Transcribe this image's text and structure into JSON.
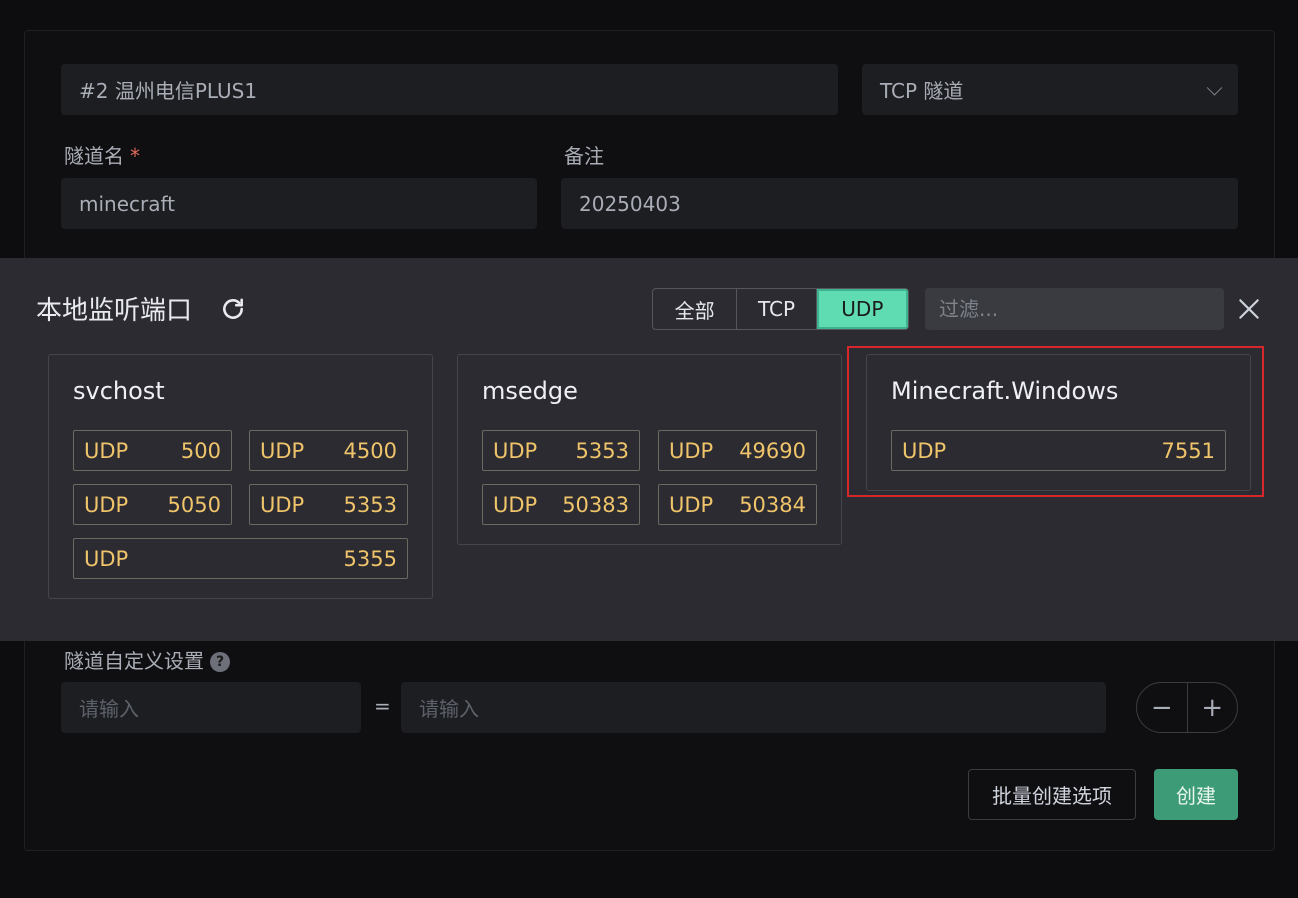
{
  "form": {
    "node_value": "#2 温州电信PLUS1",
    "tunnel_type_value": "TCP 隧道",
    "tunnel_name_label": "隧道名",
    "required_mark": "*",
    "tunnel_name_value": "minecraft",
    "remark_label": "备注",
    "remark_value": "20250403",
    "custom_settings_label": "隧道自定义设置",
    "help_glyph": "?",
    "key_placeholder": "请输入",
    "equals": "=",
    "value_placeholder": "请输入",
    "minus": "−",
    "plus": "+",
    "batch_button": "批量创建选项",
    "create_button": "创建"
  },
  "panel": {
    "title": "本地监听端口",
    "refresh_icon": "refresh-icon",
    "filters": [
      "全部",
      "TCP",
      "UDP"
    ],
    "active_filter": "UDP",
    "filter_placeholder": "过滤...",
    "close_icon": "close-icon",
    "processes": [
      {
        "name": "svchost",
        "ports": [
          {
            "proto": "UDP",
            "port": "500"
          },
          {
            "proto": "UDP",
            "port": "4500"
          },
          {
            "proto": "UDP",
            "port": "5050"
          },
          {
            "proto": "UDP",
            "port": "5353"
          },
          {
            "proto": "UDP",
            "port": "5355"
          }
        ]
      },
      {
        "name": "msedge",
        "ports": [
          {
            "proto": "UDP",
            "port": "5353"
          },
          {
            "proto": "UDP",
            "port": "49690"
          },
          {
            "proto": "UDP",
            "port": "50383"
          },
          {
            "proto": "UDP",
            "port": "50384"
          }
        ]
      },
      {
        "name": "Minecraft.Windows",
        "ports": [
          {
            "proto": "UDP",
            "port": "7551"
          }
        ]
      }
    ]
  },
  "colors": {
    "accent": "#5fdcb1",
    "primary_button": "#3e9b77",
    "port_text": "#f0c46a",
    "highlight_box": "#d8272c"
  }
}
